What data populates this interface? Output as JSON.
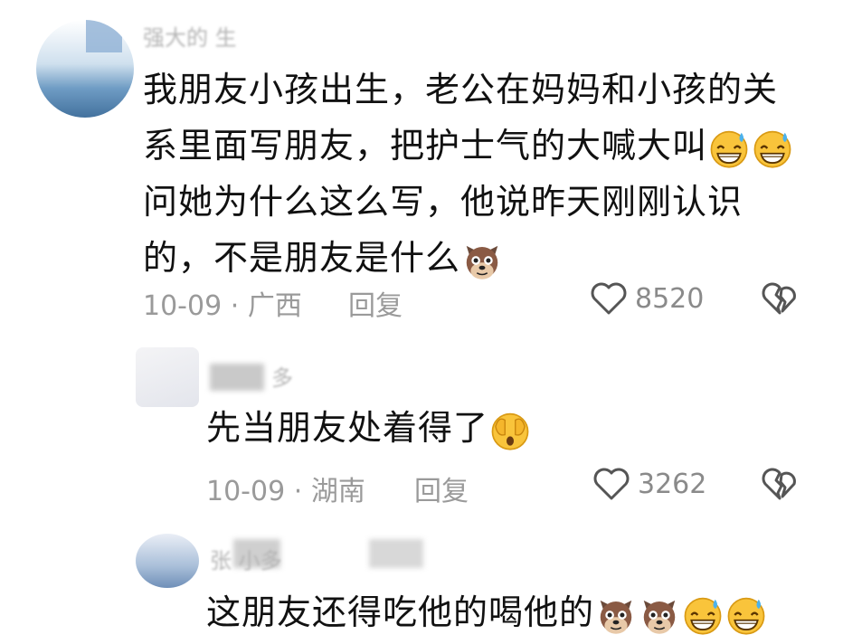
{
  "comments": [
    {
      "author": "强大的 生",
      "text_lines": [
        "我朋友小孩出生，老公在妈妈和小孩的关",
        "系里面写朋友，把护士气的大喊大叫",
        "问她为什么这么写，他说昨天刚刚认识",
        "的，不是朋友是什么"
      ],
      "date": "10-09",
      "sep": "·",
      "location": "广西",
      "reply_label": "回复",
      "like_count": "8520"
    },
    {
      "author": "多",
      "text": "先当朋友处着得了",
      "date": "10-09",
      "sep": "·",
      "location": "湖南",
      "reply_label": "回复",
      "like_count": "3262"
    },
    {
      "author": "张 小多",
      "text": "这朋友还得吃他的喝他的"
    }
  ],
  "icons": {
    "like": "heart-outline-icon",
    "dislike": "broken-heart-icon",
    "emoji_laugh_sweat": "grinning-sweat-emoji",
    "emoji_dog": "dog-face-emoji",
    "emoji_shy": "face-peeking-emoji"
  },
  "colors": {
    "meta": "#9a9a9a",
    "text": "#111111"
  }
}
